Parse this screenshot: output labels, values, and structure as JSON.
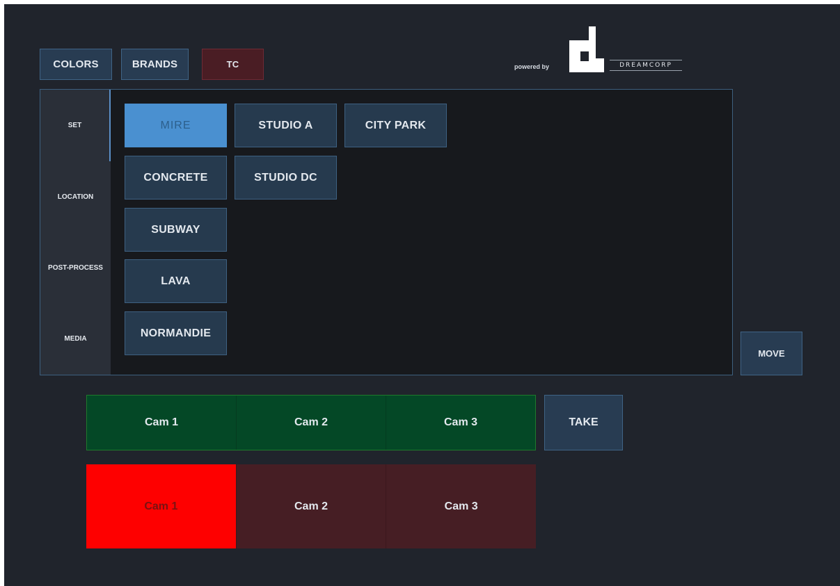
{
  "top_buttons": {
    "colors": "COLORS",
    "brands": "BRANDS",
    "tc": "TC"
  },
  "branding": {
    "powered_by": "powered by",
    "logo_text": "DREAMCORP",
    "logo_icon": "dreamcorp-logo-icon"
  },
  "sidebar": {
    "items": [
      {
        "label": "SET",
        "active": true
      },
      {
        "label": "LOCATION",
        "active": false
      },
      {
        "label": "POST-PROCESS",
        "active": false
      },
      {
        "label": "MEDIA",
        "active": false
      }
    ]
  },
  "sets": {
    "items": [
      {
        "label": "MIRE",
        "selected": true
      },
      {
        "label": "STUDIO A",
        "selected": false
      },
      {
        "label": "CITY PARK",
        "selected": false
      },
      {
        "label": "CONCRETE",
        "selected": false
      },
      {
        "label": "STUDIO DC",
        "selected": false
      },
      {
        "label": "SUBWAY",
        "selected": false
      },
      {
        "label": "LAVA",
        "selected": false
      },
      {
        "label": "NORMANDIE",
        "selected": false
      }
    ]
  },
  "move_label": "MOVE",
  "preview": {
    "cams": [
      "Cam 1",
      "Cam 2",
      "Cam 3"
    ]
  },
  "take_label": "TAKE",
  "program": {
    "cams": [
      "Cam 1",
      "Cam 2",
      "Cam 3"
    ],
    "live_index": 0
  },
  "colors": {
    "background": "#20242c",
    "accent_blue": "#4a90d0",
    "preview_green": "#044826",
    "program_dark_red": "#461e24",
    "live_red": "#fe0000",
    "tc_red": "#4a1d24"
  }
}
